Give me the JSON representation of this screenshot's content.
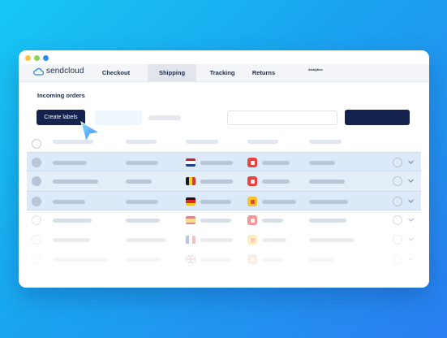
{
  "nav": {
    "logo_text": "sendcloud",
    "items": [
      {
        "label": "Checkout",
        "active": false
      },
      {
        "label": "Shipping",
        "active": true
      },
      {
        "label": "Tracking",
        "active": false
      },
      {
        "label": "Returns",
        "active": false
      }
    ],
    "small_item": "Analytics"
  },
  "page": {
    "title": "Incoming orders",
    "create_button": "Create labels"
  },
  "rows": [
    {
      "flag": "netherlands",
      "carrier": "red-carrier",
      "selected": true
    },
    {
      "flag": "belgium",
      "carrier": "red-carrier",
      "selected": true
    },
    {
      "flag": "germany",
      "carrier": "yellow-carrier",
      "selected": true
    },
    {
      "flag": "spain",
      "carrier": "red-carrier",
      "selected": false
    },
    {
      "flag": "france",
      "carrier": "yellow-carrier",
      "selected": false
    },
    {
      "flag": "united-kingdom",
      "carrier": "orange-carrier",
      "selected": false
    }
  ],
  "colors": {
    "accent_dark": "#13234d",
    "highlight_row": "#dce9f8",
    "background_gradient_start": "#17c8f4",
    "background_gradient_end": "#2a7ff0"
  }
}
